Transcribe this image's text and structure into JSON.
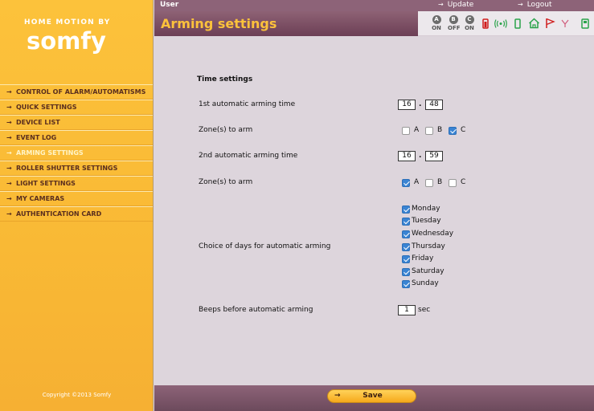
{
  "brand": {
    "top": "HOME MOTION BY",
    "name": "somfy",
    "copyright": "Copyright ©2013 Somfy"
  },
  "menu": [
    {
      "label": "CONTROL OF ALARM/AUTOMATISMS"
    },
    {
      "label": "QUICK SETTINGS"
    },
    {
      "label": "DEVICE LIST"
    },
    {
      "label": "EVENT LOG"
    },
    {
      "label": "ARMING SETTINGS",
      "active": true
    },
    {
      "label": "ROLLER SHUTTER SETTINGS"
    },
    {
      "label": "LIGHT SETTINGS"
    },
    {
      "label": "MY CAMERAS"
    },
    {
      "label": "AUTHENTICATION CARD"
    }
  ],
  "topbar": {
    "user": "User",
    "update": "Update",
    "logout": "Logout"
  },
  "page_title": "Arming settings",
  "status": {
    "zones": [
      {
        "zone": "A",
        "state": "ON"
      },
      {
        "zone": "B",
        "state": "OFF"
      },
      {
        "zone": "C",
        "state": "ON"
      }
    ],
    "icons": [
      "battery-icon",
      "radio-signal-icon",
      "door-sensor-icon",
      "house-icon",
      "flag-icon",
      "antenna-icon",
      "panel-icon"
    ]
  },
  "form": {
    "section_title": "Time settings",
    "arming1": {
      "label": "1st automatic arming time",
      "hour": "16",
      "minute": "48",
      "sep": "."
    },
    "zones1": {
      "label": "Zone(s) to arm",
      "A": false,
      "B": false,
      "C": true
    },
    "arming2": {
      "label": "2nd automatic arming time",
      "hour": "16",
      "minute": "59",
      "sep": "."
    },
    "zones2": {
      "label": "Zone(s) to arm",
      "A": true,
      "B": false,
      "C": false
    },
    "zone_labels": {
      "A": "A",
      "B": "B",
      "C": "C"
    },
    "days_label": "Choice of days for automatic arming",
    "days": [
      {
        "label": "Monday",
        "checked": true
      },
      {
        "label": "Tuesday",
        "checked": true
      },
      {
        "label": "Wednesday",
        "checked": true
      },
      {
        "label": "Thursday",
        "checked": true
      },
      {
        "label": "Friday",
        "checked": true
      },
      {
        "label": "Saturday",
        "checked": true
      },
      {
        "label": "Sunday",
        "checked": true
      }
    ],
    "beeps": {
      "label": "Beeps before automatic arming",
      "value": "1",
      "unit": "sec"
    }
  },
  "save_label": "Save",
  "colors": {
    "accent": "#fcc23b",
    "header": "#8d6378",
    "content_bg": "#ddd5dc",
    "checkbox": "#3a84d3"
  }
}
